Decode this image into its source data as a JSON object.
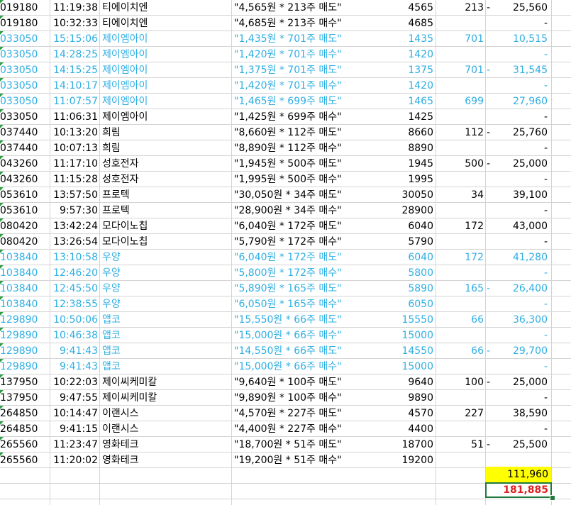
{
  "rows": [
    {
      "code": "019180",
      "time": "11:19:38",
      "name": "티에이치엔",
      "memo": "\"4,565원 * 213주 매도\"",
      "price": "4565",
      "qty": "213",
      "sign": "-",
      "pnl": "25,560",
      "hl": false
    },
    {
      "code": "019180",
      "time": "10:32:33",
      "name": "티에이치엔",
      "memo": "\"4,685원 * 213주 매수\"",
      "price": "4685",
      "qty": "",
      "sign": "",
      "pnl": "-",
      "hl": false
    },
    {
      "code": "033050",
      "time": "15:15:06",
      "name": "제이엠아이",
      "memo": "\"1,435원 * 701주 매도\"",
      "price": "1435",
      "qty": "701",
      "sign": "",
      "pnl": "10,515",
      "hl": true
    },
    {
      "code": "033050",
      "time": "14:28:25",
      "name": "제이엠아이",
      "memo": "\"1,420원 * 701주 매수\"",
      "price": "1420",
      "qty": "",
      "sign": "",
      "pnl": "-",
      "hl": true
    },
    {
      "code": "033050",
      "time": "14:15:25",
      "name": "제이엠아이",
      "memo": "\"1,375원 * 701주 매도\"",
      "price": "1375",
      "qty": "701",
      "sign": "-",
      "pnl": "31,545",
      "hl": true
    },
    {
      "code": "033050",
      "time": "14:10:17",
      "name": "제이엠아이",
      "memo": "\"1,420원 * 701주 매수\"",
      "price": "1420",
      "qty": "",
      "sign": "",
      "pnl": "-",
      "hl": true
    },
    {
      "code": "033050",
      "time": "11:07:57",
      "name": "제이엠아이",
      "memo": "\"1,465원 * 699주 매도\"",
      "price": "1465",
      "qty": "699",
      "sign": "",
      "pnl": "27,960",
      "hl": true
    },
    {
      "code": "033050",
      "time": "11:06:31",
      "name": "제이엠아이",
      "memo": "\"1,425원 * 699주 매수\"",
      "price": "1425",
      "qty": "",
      "sign": "",
      "pnl": "-",
      "hl": false
    },
    {
      "code": "037440",
      "time": "10:13:20",
      "name": "희림",
      "memo": "\"8,660원 * 112주 매도\"",
      "price": "8660",
      "qty": "112",
      "sign": "-",
      "pnl": "25,760",
      "hl": false
    },
    {
      "code": "037440",
      "time": "10:07:13",
      "name": "희림",
      "memo": "\"8,890원 * 112주 매수\"",
      "price": "8890",
      "qty": "",
      "sign": "",
      "pnl": "-",
      "hl": false
    },
    {
      "code": "043260",
      "time": "11:17:10",
      "name": "성호전자",
      "memo": "\"1,945원 * 500주 매도\"",
      "price": "1945",
      "qty": "500",
      "sign": "-",
      "pnl": "25,000",
      "hl": false
    },
    {
      "code": "043260",
      "time": "11:15:28",
      "name": "성호전자",
      "memo": "\"1,995원 * 500주 매수\"",
      "price": "1995",
      "qty": "",
      "sign": "",
      "pnl": "-",
      "hl": false
    },
    {
      "code": "053610",
      "time": "13:57:50",
      "name": "프로텍",
      "memo": "\"30,050원 * 34주 매도\"",
      "price": "30050",
      "qty": "34",
      "sign": "",
      "pnl": "39,100",
      "hl": false
    },
    {
      "code": "053610",
      "time": "9:57:30",
      "name": "프로텍",
      "memo": "\"28,900원 * 34주 매수\"",
      "price": "28900",
      "qty": "",
      "sign": "",
      "pnl": "-",
      "hl": false
    },
    {
      "code": "080420",
      "time": "13:42:24",
      "name": "모다이노칩",
      "memo": "\"6,040원 * 172주 매도\"",
      "price": "6040",
      "qty": "172",
      "sign": "",
      "pnl": "43,000",
      "hl": false
    },
    {
      "code": "080420",
      "time": "13:26:54",
      "name": "모다이노칩",
      "memo": "\"5,790원 * 172주 매수\"",
      "price": "5790",
      "qty": "",
      "sign": "",
      "pnl": "-",
      "hl": false
    },
    {
      "code": "103840",
      "time": "13:10:58",
      "name": "우양",
      "memo": "\"6,040원 * 172주 매도\"",
      "price": "6040",
      "qty": "172",
      "sign": "",
      "pnl": "41,280",
      "hl": true
    },
    {
      "code": "103840",
      "time": "12:46:20",
      "name": "우양",
      "memo": "\"5,800원 * 172주 매수\"",
      "price": "5800",
      "qty": "",
      "sign": "",
      "pnl": "-",
      "hl": true
    },
    {
      "code": "103840",
      "time": "12:45:50",
      "name": "우양",
      "memo": "\"5,890원 * 165주 매도\"",
      "price": "5890",
      "qty": "165",
      "sign": "-",
      "pnl": "26,400",
      "hl": true
    },
    {
      "code": "103840",
      "time": "12:38:55",
      "name": "우양",
      "memo": "\"6,050원 * 165주 매수\"",
      "price": "6050",
      "qty": "",
      "sign": "",
      "pnl": "-",
      "hl": true
    },
    {
      "code": "129890",
      "time": "10:50:06",
      "name": "앱코",
      "memo": "\"15,550원 * 66주 매도\"",
      "price": "15550",
      "qty": "66",
      "sign": "",
      "pnl": "36,300",
      "hl": true
    },
    {
      "code": "129890",
      "time": "10:46:38",
      "name": "앱코",
      "memo": "\"15,000원 * 66주 매수\"",
      "price": "15000",
      "qty": "",
      "sign": "",
      "pnl": "-",
      "hl": true
    },
    {
      "code": "129890",
      "time": "9:41:43",
      "name": "앱코",
      "memo": "\"14,550원 * 66주 매도\"",
      "price": "14550",
      "qty": "66",
      "sign": "-",
      "pnl": "29,700",
      "hl": true
    },
    {
      "code": "129890",
      "time": "9:41:43",
      "name": "앱코",
      "memo": "\"15,000원 * 66주 매수\"",
      "price": "15000",
      "qty": "",
      "sign": "",
      "pnl": "-",
      "hl": true
    },
    {
      "code": "137950",
      "time": "10:22:03",
      "name": "제이씨케미칼",
      "memo": "\"9,640원 * 100주 매도\"",
      "price": "9640",
      "qty": "100",
      "sign": "-",
      "pnl": "25,000",
      "hl": false
    },
    {
      "code": "137950",
      "time": "9:47:55",
      "name": "제이씨케미칼",
      "memo": "\"9,890원 * 100주 매수\"",
      "price": "9890",
      "qty": "",
      "sign": "",
      "pnl": "-",
      "hl": false
    },
    {
      "code": "264850",
      "time": "10:14:47",
      "name": "이랜시스",
      "memo": "\"4,570원 * 227주 매도\"",
      "price": "4570",
      "qty": "227",
      "sign": "",
      "pnl": "38,590",
      "hl": false
    },
    {
      "code": "264850",
      "time": "9:41:15",
      "name": "이랜시스",
      "memo": "\"4,400원 * 227주 매수\"",
      "price": "4400",
      "qty": "",
      "sign": "",
      "pnl": "-",
      "hl": false
    },
    {
      "code": "265560",
      "time": "11:23:47",
      "name": "영화테크",
      "memo": "\"18,700원 * 51주 매도\"",
      "price": "18700",
      "qty": "51",
      "sign": "-",
      "pnl": "25,500",
      "hl": false
    },
    {
      "code": "265560",
      "time": "11:20:02",
      "name": "영화테크",
      "memo": "\"19,200원 * 51주 매수\"",
      "price": "19200",
      "qty": "",
      "sign": "",
      "pnl": "",
      "hl": false
    }
  ],
  "totals": {
    "highlighted_sum": "111,960",
    "selected_sum": "181,885"
  },
  "colors": {
    "accent": "#2eaee3",
    "total_red": "#e02020",
    "highlight_yellow": "#ffff00",
    "selection_green": "#1f7a3d"
  }
}
